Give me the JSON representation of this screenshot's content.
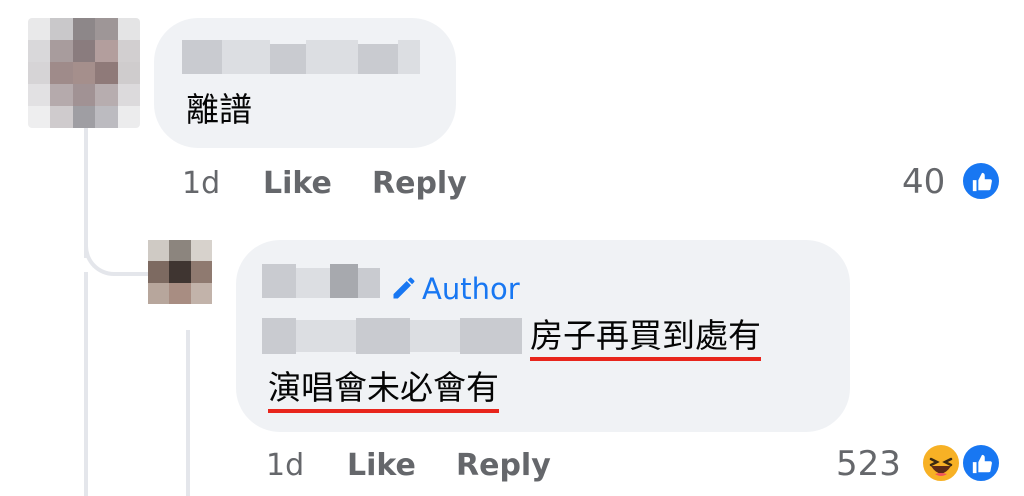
{
  "comments": [
    {
      "text": "離譜",
      "time": "1d",
      "like_label": "Like",
      "reply_label": "Reply",
      "reaction_count": "40",
      "reactions": [
        "like-icon"
      ]
    },
    {
      "author_badge": "Author",
      "text_line1": "房子再買到處有",
      "text_line2": "演唱會未必會有",
      "time": "1d",
      "like_label": "Like",
      "reply_label": "Reply",
      "reaction_count": "523",
      "reactions": [
        "haha-icon",
        "like-icon"
      ]
    }
  ],
  "colors": {
    "bubble": "#f0f2f5",
    "meta_text": "#65676b",
    "accent": "#1877f2",
    "highlight_underline": "#e8251c"
  }
}
